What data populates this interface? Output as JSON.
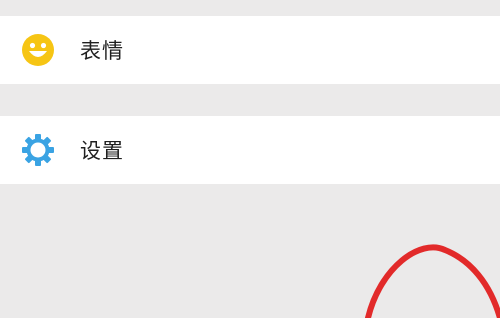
{
  "menu": {
    "items": [
      {
        "label": "表情",
        "icon": "smiley-icon",
        "icon_color": "#f6c514"
      },
      {
        "label": "设置",
        "icon": "gear-icon",
        "icon_color": "#3aa3e3"
      }
    ]
  },
  "colors": {
    "background": "#ebeaea",
    "row_background": "#ffffff",
    "annotation": "#e22a2a"
  }
}
